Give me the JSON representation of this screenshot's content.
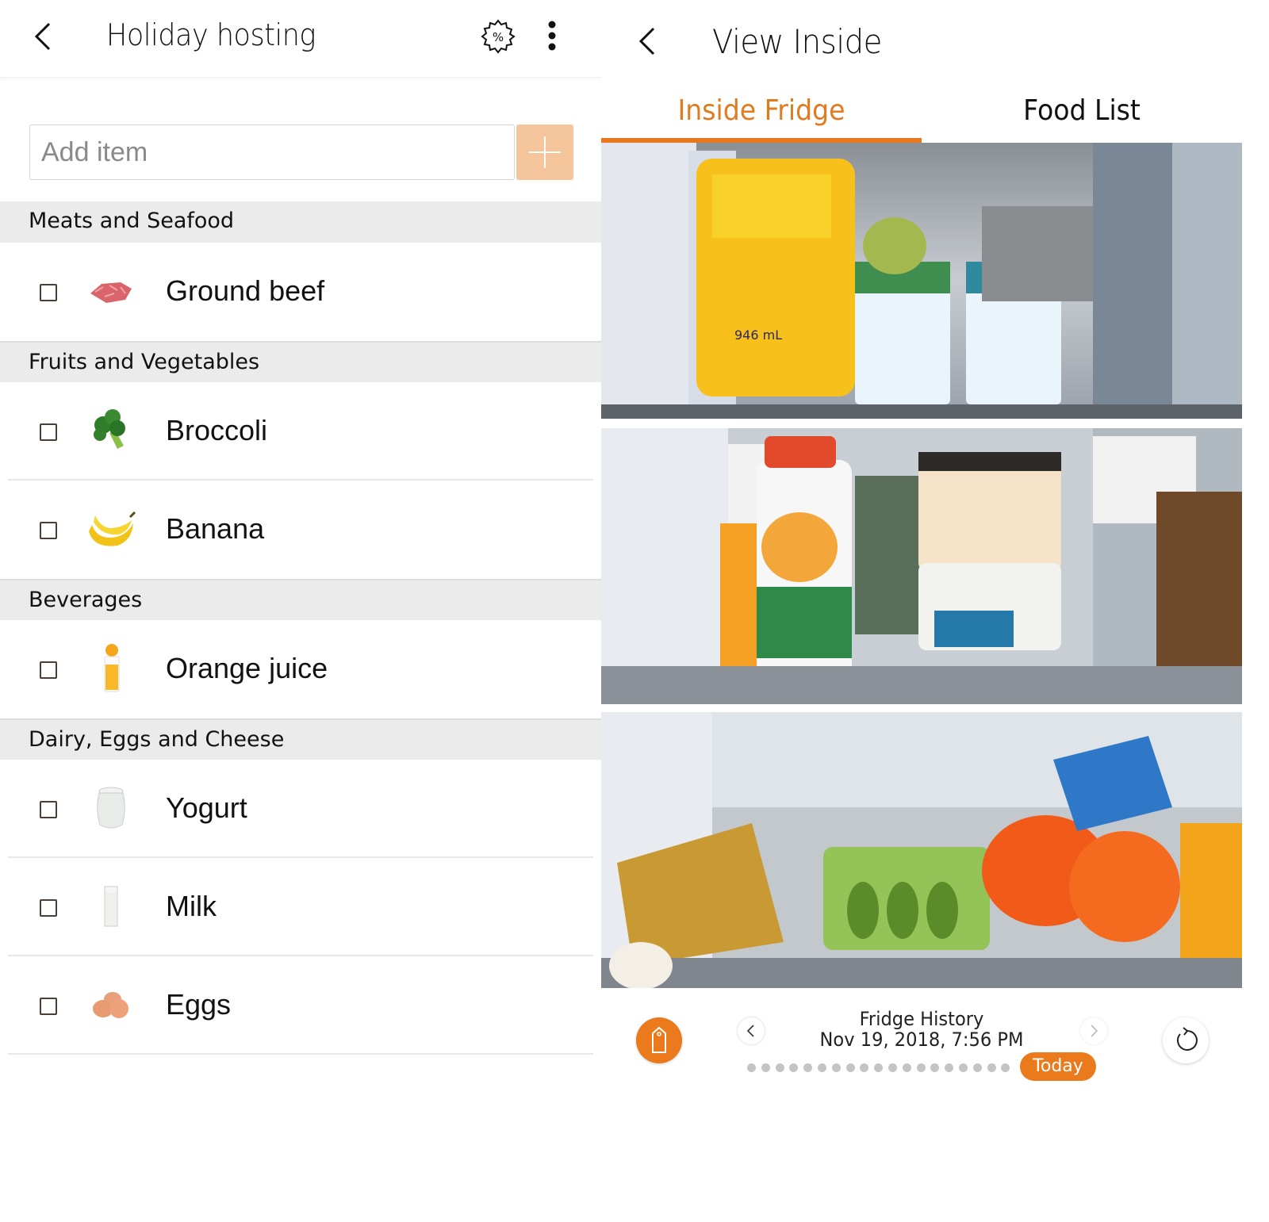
{
  "shopping_list": {
    "title": "Holiday hosting",
    "icons": {
      "back": "chevron-left-icon",
      "promo": "discount-badge-icon",
      "more": "more-vertical-icon",
      "add": "plus-icon"
    },
    "add_input": {
      "placeholder": "Add item",
      "value": ""
    },
    "categories": [
      {
        "name": "Meats and Seafood",
        "items": [
          {
            "label": "Ground beef",
            "icon": "ground-beef-icon",
            "checked": false
          }
        ]
      },
      {
        "name": "Fruits and Vegetables",
        "items": [
          {
            "label": "Broccoli",
            "icon": "broccoli-icon",
            "checked": false
          },
          {
            "label": "Banana",
            "icon": "banana-icon",
            "checked": false
          }
        ]
      },
      {
        "name": "Beverages",
        "items": [
          {
            "label": "Orange juice",
            "icon": "orange-juice-icon",
            "checked": false
          }
        ]
      },
      {
        "name": "Dairy, Eggs and Cheese",
        "items": [
          {
            "label": "Yogurt",
            "icon": "yogurt-icon",
            "checked": false
          },
          {
            "label": "Milk",
            "icon": "milk-icon",
            "checked": false
          },
          {
            "label": "Eggs",
            "icon": "eggs-icon",
            "checked": false
          }
        ]
      }
    ]
  },
  "view_inside": {
    "title": "View Inside",
    "tabs": [
      {
        "label": "Inside Fridge",
        "active": true
      },
      {
        "label": "Food List",
        "active": false
      }
    ],
    "photos": [
      {
        "alt": "Top shelf: mayonnaise jar, yogurt cups, cabbage, pot",
        "label_946": "946 mL"
      },
      {
        "alt": "Middle shelf: Trader Joe's peach smoothie, olive tapenade, smoked salmon dip"
      },
      {
        "alt": "Bottom shelf: bread, cucumbers in clamshell, oranges in net bag"
      }
    ],
    "history": {
      "label": "Fridge History",
      "date": "Nov 19, 2018, 7:56 PM",
      "dot_count": 19,
      "today_label": "Today"
    },
    "icons": {
      "back": "chevron-left-icon",
      "tag": "tag-icon",
      "prev": "chevron-left-icon",
      "next": "chevron-right-icon",
      "refresh": "refresh-icon"
    }
  },
  "colors": {
    "accent": "#ea7a1c",
    "tab_active": "#e07b1f",
    "add_button": "#f5c59b",
    "category_bg": "#ebebeb"
  }
}
